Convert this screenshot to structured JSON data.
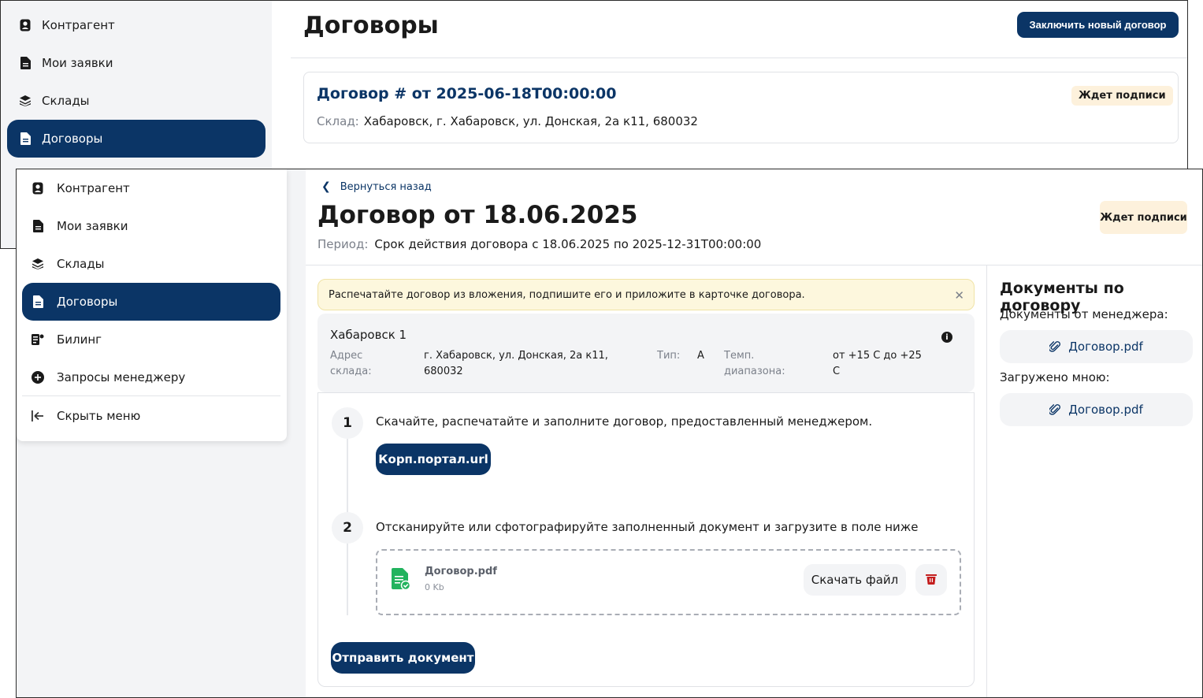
{
  "back_window": {
    "sidebar": {
      "items": [
        {
          "label": "Контрагент",
          "icon": "user-badge-icon"
        },
        {
          "label": "Мои заявки",
          "icon": "document-icon"
        },
        {
          "label": "Склады",
          "icon": "layers-icon"
        },
        {
          "label": "Договоры",
          "icon": "contract-icon",
          "active": true
        }
      ]
    },
    "title": "Договоры",
    "new_contract_button": "Заключить новый договор",
    "card": {
      "title": "Договор # от 2025-06-18T00:00:00",
      "warehouse_label": "Склад:",
      "warehouse_value": "Хабаровск, г. Хабаровск, ул. Донская, 2а к11, 680032",
      "status": "Ждет подписи"
    }
  },
  "front_window": {
    "menu": {
      "items": [
        {
          "label": "Контрагент",
          "icon": "user-badge-icon"
        },
        {
          "label": "Мои заявки",
          "icon": "document-icon"
        },
        {
          "label": "Склады",
          "icon": "layers-icon"
        },
        {
          "label": "Договоры",
          "icon": "contract-icon",
          "active": true
        },
        {
          "label": "Билинг",
          "icon": "billing-icon"
        },
        {
          "label": "Запросы менеджеру",
          "icon": "plus-circle-icon"
        }
      ],
      "hide_menu": "Скрыть меню"
    },
    "back_link": "Вернуться назад",
    "title": "Договор от 18.06.2025",
    "status": "Ждет подписи",
    "period_label": "Период:",
    "period_value": "Срок действия договора с 18.06.2025 по 2025-12-31T00:00:00",
    "alert": "Распечатайте договор из вложения, подпишите его и приложите в карточке договора.",
    "warehouse": {
      "name": "Хабаровск 1",
      "address_label_1": "Адрес",
      "address_label_2": "склада:",
      "address_value_1": "г. Хабаровск, ул. Донская, 2а к11,",
      "address_value_2": "680032",
      "type_label": "Тип:",
      "type_value": "А",
      "temp_label_1": "Темп.",
      "temp_label_2": "диапазона:",
      "temp_value_1": "от +15 С до +25",
      "temp_value_2": "С"
    },
    "steps": [
      {
        "number": "1",
        "text": "Скачайте, распечатайте и заполните договор, предоставленный менеджером.",
        "button": "Корп.портал.url"
      },
      {
        "number": "2",
        "text": "Отсканируйте или сфотографируйте заполненный документ и загрузите в поле ниже"
      }
    ],
    "uploaded_file": {
      "name": "Договор.pdf",
      "size": "0 Kb",
      "download_button": "Скачать файл"
    },
    "send_button": "Отправить документ",
    "docs": {
      "title": "Документы по договору",
      "from_manager_label": "Документы от менеджера:",
      "from_manager_file": "Договор.pdf",
      "uploaded_label": "Загружено мною:",
      "uploaded_file": "Договор.pdf"
    }
  },
  "colors": {
    "primary": "#0b3566",
    "badge_bg": "#fdf1dc",
    "alert_bg": "#fdf7dd",
    "success": "#22b35e",
    "danger": "#c41e1e"
  }
}
